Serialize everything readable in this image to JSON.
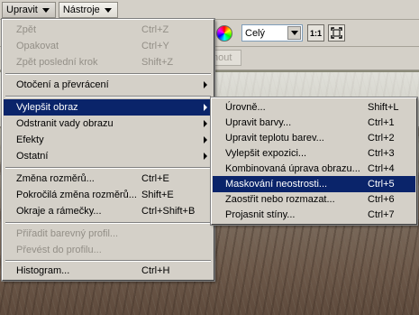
{
  "menubar": {
    "items": [
      {
        "label": "Upravit"
      },
      {
        "label": "Nástroje"
      }
    ]
  },
  "toolbar": {
    "zoom_value": "Celý",
    "actual_size_label": "1:1",
    "strip_button_label": "mout"
  },
  "main_menu": {
    "items": [
      {
        "label": "Zpět",
        "shortcut": "Ctrl+Z",
        "disabled": true
      },
      {
        "label": "Opakovat",
        "shortcut": "Ctrl+Y",
        "disabled": true
      },
      {
        "label": "Zpět poslední krok",
        "shortcut": "Shift+Z",
        "disabled": true
      },
      {
        "label": "Otočení a převrácení",
        "submenu": true
      },
      {
        "label": "Vylepšit obraz",
        "submenu": true,
        "highlighted": true
      },
      {
        "label": "Odstranit vady obrazu",
        "submenu": true
      },
      {
        "label": "Efekty",
        "submenu": true
      },
      {
        "label": "Ostatní",
        "submenu": true
      },
      {
        "label": "Změna rozměrů...",
        "shortcut": "Ctrl+E"
      },
      {
        "label": "Pokročilá změna rozměrů...",
        "shortcut": "Shift+E"
      },
      {
        "label": "Okraje a rámečky...",
        "shortcut": "Ctrl+Shift+B"
      },
      {
        "label": "Přiřadit barevný profil...",
        "disabled": true
      },
      {
        "label": "Převést do profilu...",
        "disabled": true
      },
      {
        "label": "Histogram...",
        "shortcut": "Ctrl+H"
      }
    ]
  },
  "sub_menu": {
    "items": [
      {
        "label": "Úrovně...",
        "shortcut": "Shift+L"
      },
      {
        "label": "Upravit barvy...",
        "shortcut": "Ctrl+1"
      },
      {
        "label": "Upravit teplotu barev...",
        "shortcut": "Ctrl+2"
      },
      {
        "label": "Vylepšit expozici...",
        "shortcut": "Ctrl+3"
      },
      {
        "label": "Kombinovaná úprava obrazu...",
        "shortcut": "Ctrl+4"
      },
      {
        "label": "Maskování neostrosti...",
        "shortcut": "Ctrl+5",
        "highlighted": true
      },
      {
        "label": "Zaostřit nebo rozmazat...",
        "shortcut": "Ctrl+6"
      },
      {
        "label": "Projasnit stíny...",
        "shortcut": "Ctrl+7"
      }
    ]
  },
  "colors": {
    "menu_bg": "#d4d0c8",
    "highlight": "#0a246a",
    "disabled_text": "#938f87"
  }
}
